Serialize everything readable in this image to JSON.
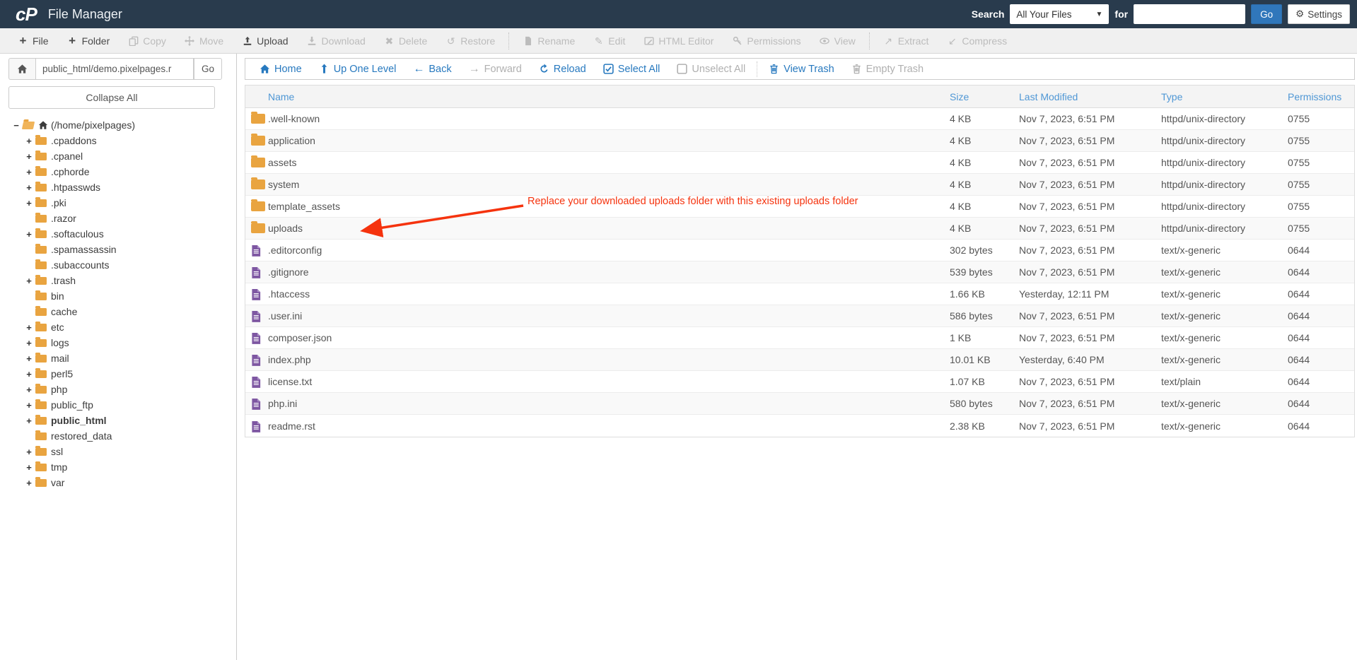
{
  "topbar": {
    "logo": "cP",
    "title": "File Manager",
    "search_label": "Search",
    "search_scope": "All Your Files",
    "for_label": "for",
    "search_value": "",
    "search_placeholder": "",
    "go_label": "Go",
    "settings_label": "Settings"
  },
  "toolbar": {
    "items": [
      {
        "label": "File",
        "icon": "plus-icon",
        "glyph": "+",
        "enabled": true,
        "divider_after": false
      },
      {
        "label": "Folder",
        "icon": "plus-icon",
        "glyph": "+",
        "enabled": true,
        "divider_after": false
      },
      {
        "label": "Copy",
        "icon": "copy-icon",
        "enabled": false,
        "divider_after": false
      },
      {
        "label": "Move",
        "icon": "move-icon",
        "enabled": false,
        "divider_after": false
      },
      {
        "label": "Upload",
        "icon": "upload-icon",
        "enabled": true,
        "divider_after": false
      },
      {
        "label": "Download",
        "icon": "download-icon",
        "enabled": false,
        "divider_after": false
      },
      {
        "label": "Delete",
        "icon": "delete-x-icon",
        "glyph": "✖",
        "enabled": false,
        "divider_after": false
      },
      {
        "label": "Restore",
        "icon": "restore-icon",
        "glyph": "↺",
        "enabled": false,
        "divider_after": true
      },
      {
        "label": "Rename",
        "icon": "rename-file-icon",
        "enabled": false,
        "divider_after": false
      },
      {
        "label": "Edit",
        "icon": "pencil-icon",
        "glyph": "✎",
        "enabled": false,
        "divider_after": false
      },
      {
        "label": "HTML Editor",
        "icon": "html-editor-icon",
        "enabled": false,
        "divider_after": false
      },
      {
        "label": "Permissions",
        "icon": "key-icon",
        "enabled": false,
        "divider_after": false
      },
      {
        "label": "View",
        "icon": "eye-icon",
        "enabled": false,
        "divider_after": true
      },
      {
        "label": "Extract",
        "icon": "extract-icon",
        "glyph": "↗",
        "enabled": false,
        "divider_after": false
      },
      {
        "label": "Compress",
        "icon": "compress-icon",
        "glyph": "↙",
        "enabled": false,
        "divider_after": false
      }
    ]
  },
  "pathbar": {
    "path_value": "public_html/demo.pixelpages.r",
    "go_label": "Go"
  },
  "navbar": {
    "items": [
      {
        "label": "Home",
        "icon": "home-icon",
        "enabled": true,
        "divider_after": false
      },
      {
        "label": "Up One Level",
        "icon": "up-arrow-icon",
        "enabled": true,
        "divider_after": false
      },
      {
        "label": "Back",
        "icon": "back-arrow-icon",
        "glyph": "←",
        "enabled": true,
        "divider_after": false
      },
      {
        "label": "Forward",
        "icon": "forward-arrow-icon",
        "glyph": "→",
        "enabled": false,
        "divider_after": false
      },
      {
        "label": "Reload",
        "icon": "reload-icon",
        "enabled": true,
        "divider_after": false
      },
      {
        "label": "Select All",
        "icon": "checkbox-checked-icon",
        "enabled": true,
        "divider_after": false
      },
      {
        "label": "Unselect All",
        "icon": "checkbox-empty-icon",
        "enabled": false,
        "divider_after": true
      },
      {
        "label": "View Trash",
        "icon": "trash-icon",
        "enabled": true,
        "divider_after": false
      },
      {
        "label": "Empty Trash",
        "icon": "trash-icon",
        "enabled": false,
        "divider_after": false
      }
    ]
  },
  "sidebar": {
    "collapse_all_label": "Collapse All",
    "tree": [
      {
        "label": "(/home/pixelpages)",
        "expander": "minus",
        "root": true,
        "bold": false
      },
      {
        "label": ".cpaddons",
        "expander": "plus",
        "bold": false
      },
      {
        "label": ".cpanel",
        "expander": "plus",
        "bold": false
      },
      {
        "label": ".cphorde",
        "expander": "plus",
        "bold": false
      },
      {
        "label": ".htpasswds",
        "expander": "plus",
        "bold": false
      },
      {
        "label": ".pki",
        "expander": "plus",
        "bold": false
      },
      {
        "label": ".razor",
        "expander": "none",
        "bold": false
      },
      {
        "label": ".softaculous",
        "expander": "plus",
        "bold": false
      },
      {
        "label": ".spamassassin",
        "expander": "none",
        "bold": false
      },
      {
        "label": ".subaccounts",
        "expander": "none",
        "bold": false
      },
      {
        "label": ".trash",
        "expander": "plus",
        "bold": false
      },
      {
        "label": "bin",
        "expander": "none",
        "bold": false
      },
      {
        "label": "cache",
        "expander": "none",
        "bold": false
      },
      {
        "label": "etc",
        "expander": "plus",
        "bold": false
      },
      {
        "label": "logs",
        "expander": "plus",
        "bold": false
      },
      {
        "label": "mail",
        "expander": "plus",
        "bold": false
      },
      {
        "label": "perl5",
        "expander": "plus",
        "bold": false
      },
      {
        "label": "php",
        "expander": "plus",
        "bold": false
      },
      {
        "label": "public_ftp",
        "expander": "plus",
        "bold": false
      },
      {
        "label": "public_html",
        "expander": "plus",
        "bold": true
      },
      {
        "label": "restored_data",
        "expander": "none",
        "bold": false
      },
      {
        "label": "ssl",
        "expander": "plus",
        "bold": false
      },
      {
        "label": "tmp",
        "expander": "plus",
        "bold": false
      },
      {
        "label": "var",
        "expander": "plus",
        "bold": false
      }
    ]
  },
  "table": {
    "columns": [
      "Name",
      "Size",
      "Last Modified",
      "Type",
      "Permissions"
    ],
    "rows": [
      {
        "name": ".well-known",
        "kind": "folder",
        "size": "4 KB",
        "modified": "Nov 7, 2023, 6:51 PM",
        "type": "httpd/unix-directory",
        "permissions": "0755"
      },
      {
        "name": "application",
        "kind": "folder",
        "size": "4 KB",
        "modified": "Nov 7, 2023, 6:51 PM",
        "type": "httpd/unix-directory",
        "permissions": "0755"
      },
      {
        "name": "assets",
        "kind": "folder",
        "size": "4 KB",
        "modified": "Nov 7, 2023, 6:51 PM",
        "type": "httpd/unix-directory",
        "permissions": "0755"
      },
      {
        "name": "system",
        "kind": "folder",
        "size": "4 KB",
        "modified": "Nov 7, 2023, 6:51 PM",
        "type": "httpd/unix-directory",
        "permissions": "0755"
      },
      {
        "name": "template_assets",
        "kind": "folder",
        "size": "4 KB",
        "modified": "Nov 7, 2023, 6:51 PM",
        "type": "httpd/unix-directory",
        "permissions": "0755"
      },
      {
        "name": "uploads",
        "kind": "folder",
        "size": "4 KB",
        "modified": "Nov 7, 2023, 6:51 PM",
        "type": "httpd/unix-directory",
        "permissions": "0755"
      },
      {
        "name": ".editorconfig",
        "kind": "file",
        "size": "302 bytes",
        "modified": "Nov 7, 2023, 6:51 PM",
        "type": "text/x-generic",
        "permissions": "0644"
      },
      {
        "name": ".gitignore",
        "kind": "file",
        "size": "539 bytes",
        "modified": "Nov 7, 2023, 6:51 PM",
        "type": "text/x-generic",
        "permissions": "0644"
      },
      {
        "name": ".htaccess",
        "kind": "file",
        "size": "1.66 KB",
        "modified": "Yesterday, 12:11 PM",
        "type": "text/x-generic",
        "permissions": "0644"
      },
      {
        "name": ".user.ini",
        "kind": "file",
        "size": "586 bytes",
        "modified": "Nov 7, 2023, 6:51 PM",
        "type": "text/x-generic",
        "permissions": "0644"
      },
      {
        "name": "composer.json",
        "kind": "file",
        "size": "1 KB",
        "modified": "Nov 7, 2023, 6:51 PM",
        "type": "text/x-generic",
        "permissions": "0644"
      },
      {
        "name": "index.php",
        "kind": "file",
        "size": "10.01 KB",
        "modified": "Yesterday, 6:40 PM",
        "type": "text/x-generic",
        "permissions": "0644"
      },
      {
        "name": "license.txt",
        "kind": "file",
        "size": "1.07 KB",
        "modified": "Nov 7, 2023, 6:51 PM",
        "type": "text/plain",
        "permissions": "0644"
      },
      {
        "name": "php.ini",
        "kind": "file",
        "size": "580 bytes",
        "modified": "Nov 7, 2023, 6:51 PM",
        "type": "text/x-generic",
        "permissions": "0644"
      },
      {
        "name": "readme.rst",
        "kind": "file",
        "size": "2.38 KB",
        "modified": "Nov 7, 2023, 6:51 PM",
        "type": "text/x-generic",
        "permissions": "0644"
      }
    ]
  },
  "annotation": {
    "text": "Replace your downloaded uploads folder with this existing uploads folder",
    "color": "#f5330e"
  },
  "colors": {
    "topbar_bg": "#293b4d",
    "link_blue": "#2779bf",
    "table_header_blue": "#4f97d5",
    "folder_orange": "#e9a440",
    "file_purple": "#7e57a2",
    "go_button_blue": "#3077bb"
  }
}
